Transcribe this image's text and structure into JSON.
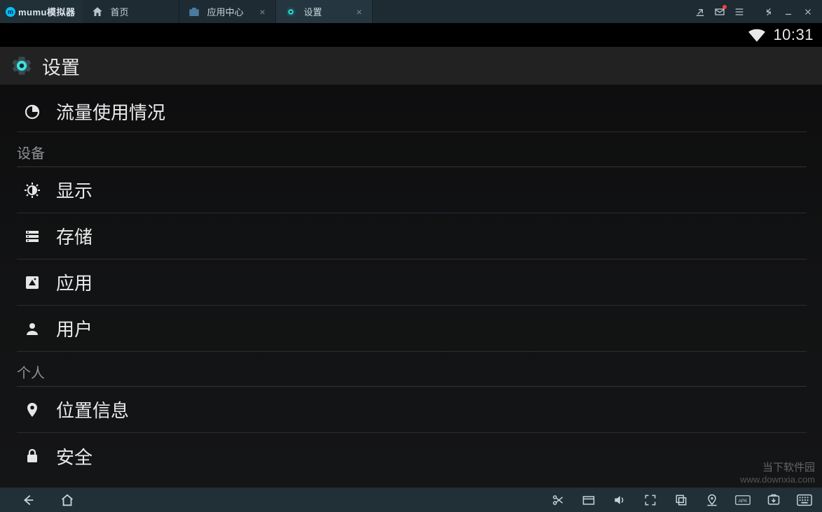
{
  "emulator": {
    "logo_text": "mumu模拟器",
    "tabs": [
      {
        "label": "首页",
        "closable": false,
        "icon": "home-icon"
      },
      {
        "label": "应用中心",
        "closable": true,
        "icon": "briefcase-icon"
      },
      {
        "label": "设置",
        "closable": true,
        "icon": "settings-gear-icon",
        "active": true
      }
    ],
    "title_icons": [
      "share-icon",
      "mail-icon",
      "menu-icon",
      "shrink-icon",
      "minimize-icon",
      "close-icon"
    ],
    "mail_has_notification": true
  },
  "statusbar": {
    "time": "10:31",
    "wifi_strength": 4
  },
  "settings": {
    "title": "设置",
    "groups": [
      {
        "header": null,
        "items": [
          {
            "icon": "data-usage-icon",
            "label": "流量使用情况"
          }
        ]
      },
      {
        "header": "设备",
        "items": [
          {
            "icon": "display-icon",
            "label": "显示"
          },
          {
            "icon": "storage-icon",
            "label": "存储"
          },
          {
            "icon": "apps-icon",
            "label": "应用"
          },
          {
            "icon": "user-icon",
            "label": "用户"
          }
        ]
      },
      {
        "header": "个人",
        "items": [
          {
            "icon": "location-icon",
            "label": "位置信息"
          },
          {
            "icon": "security-icon",
            "label": "安全"
          }
        ]
      }
    ]
  },
  "bottombar": {
    "nav": [
      "back-icon",
      "home-nav-icon"
    ],
    "tools": [
      "scissors-icon",
      "folder-icon",
      "volume-icon",
      "fullscreen-icon",
      "multiwin-icon",
      "gps-icon",
      "apk-icon",
      "screenshot-icon",
      "keyboard-icon"
    ]
  },
  "watermark": {
    "main": "当下软件园",
    "sub": "www.downxia.com"
  }
}
